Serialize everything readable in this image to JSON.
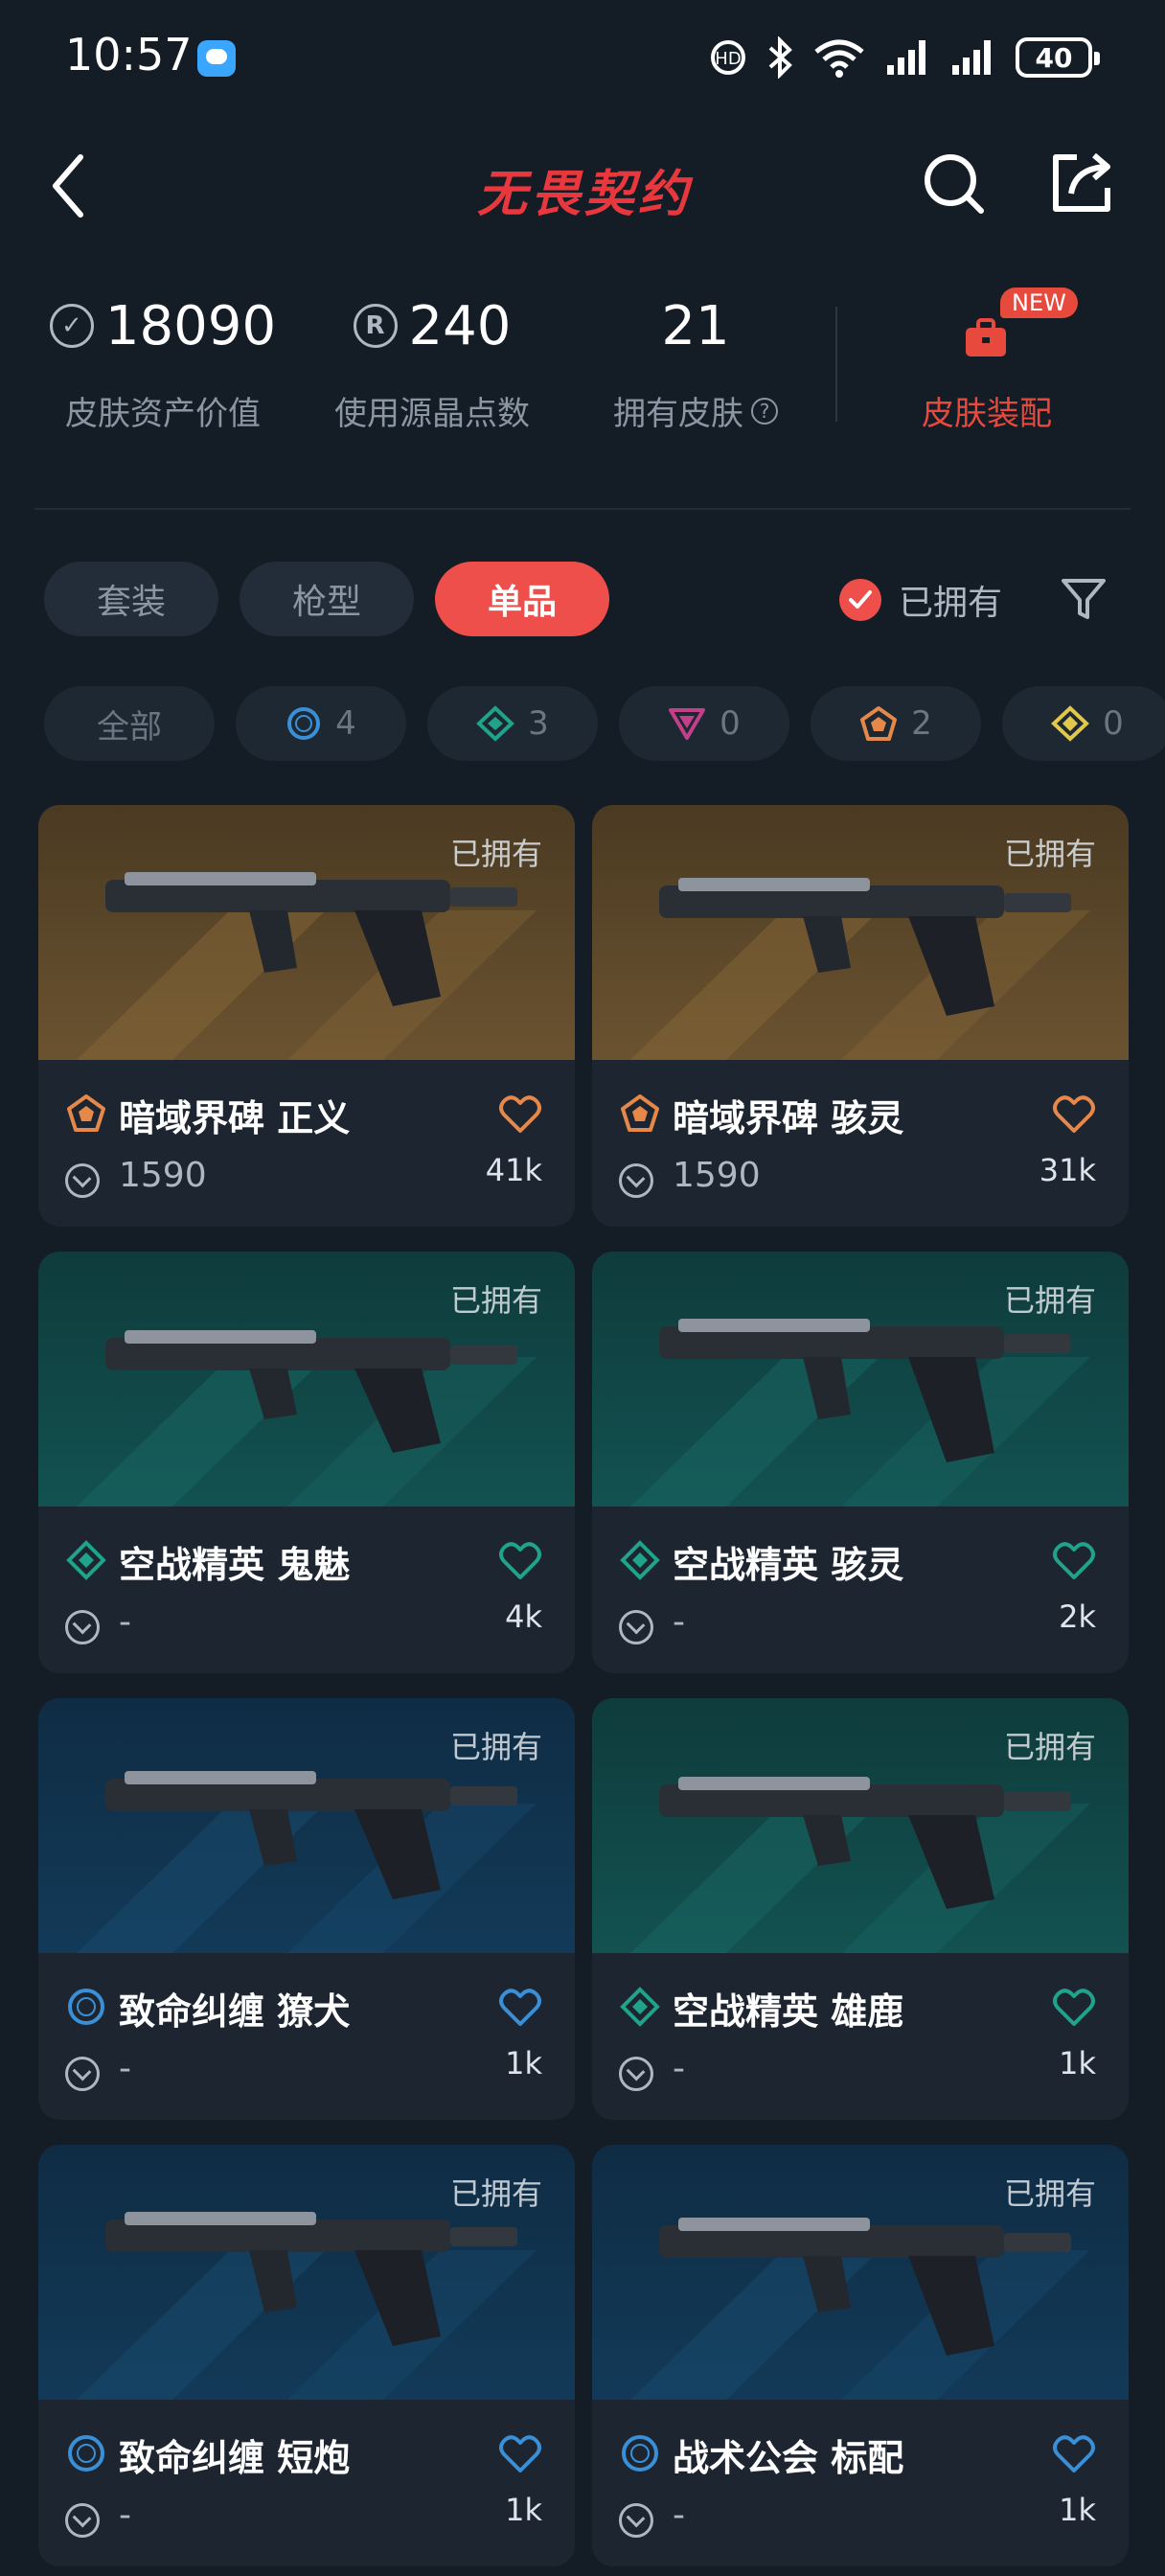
{
  "status_bar": {
    "time": "10:57",
    "battery": "40"
  },
  "header": {
    "title": "无畏契约"
  },
  "stats": [
    {
      "value": "18090",
      "label": "皮肤资产价值",
      "icon": "vp-coin-icon"
    },
    {
      "value": "240",
      "label": "使用源晶点数",
      "icon": "radianite-icon"
    },
    {
      "value": "21",
      "label": "拥有皮肤",
      "icon": "help-icon"
    }
  ],
  "loadout": {
    "label": "皮肤装配",
    "badge": "NEW"
  },
  "tabs": [
    {
      "label": "套装",
      "active": false
    },
    {
      "label": "枪型",
      "active": false
    },
    {
      "label": "单品",
      "active": true
    }
  ],
  "owned_filter": {
    "label": "已拥有",
    "checked": true
  },
  "tiers": [
    {
      "label": "全部"
    },
    {
      "count": "4",
      "tier": "select",
      "color": "#3a8fd6"
    },
    {
      "count": "3",
      "tier": "deluxe",
      "color": "#1fa38a"
    },
    {
      "count": "0",
      "tier": "premium",
      "color": "#c43e8a"
    },
    {
      "count": "2",
      "tier": "exclusive",
      "color": "#e6884a"
    },
    {
      "count": "0",
      "tier": "ultra",
      "color": "#e2c84a"
    }
  ],
  "skins": [
    {
      "name": "暗域界碑 正义",
      "price": "1590",
      "likes": "41k",
      "owned": "已拥有",
      "tier": "exclusive",
      "tier_color": "#e6884a",
      "bg": "brown"
    },
    {
      "name": "暗域界碑 骇灵",
      "price": "1590",
      "likes": "31k",
      "owned": "已拥有",
      "tier": "exclusive",
      "tier_color": "#e6884a",
      "bg": "brown"
    },
    {
      "name": "空战精英 鬼魅",
      "price": "-",
      "likes": "4k",
      "owned": "已拥有",
      "tier": "deluxe",
      "tier_color": "#1fa38a",
      "bg": "teal"
    },
    {
      "name": "空战精英 骇灵",
      "price": "-",
      "likes": "2k",
      "owned": "已拥有",
      "tier": "deluxe",
      "tier_color": "#1fa38a",
      "bg": "teal"
    },
    {
      "name": "致命纠缠 獠犬",
      "price": "-",
      "likes": "1k",
      "owned": "已拥有",
      "tier": "select",
      "tier_color": "#3a8fd6",
      "bg": "blue"
    },
    {
      "name": "空战精英 雄鹿",
      "price": "-",
      "likes": "1k",
      "owned": "已拥有",
      "tier": "deluxe",
      "tier_color": "#1fa38a",
      "bg": "teal"
    },
    {
      "name": "致命纠缠 短炮",
      "price": "-",
      "likes": "1k",
      "owned": "已拥有",
      "tier": "select",
      "tier_color": "#3a8fd6",
      "bg": "blue"
    },
    {
      "name": "战术公会 标配",
      "price": "-",
      "likes": "1k",
      "owned": "已拥有",
      "tier": "select",
      "tier_color": "#3a8fd6",
      "bg": "blue"
    }
  ]
}
